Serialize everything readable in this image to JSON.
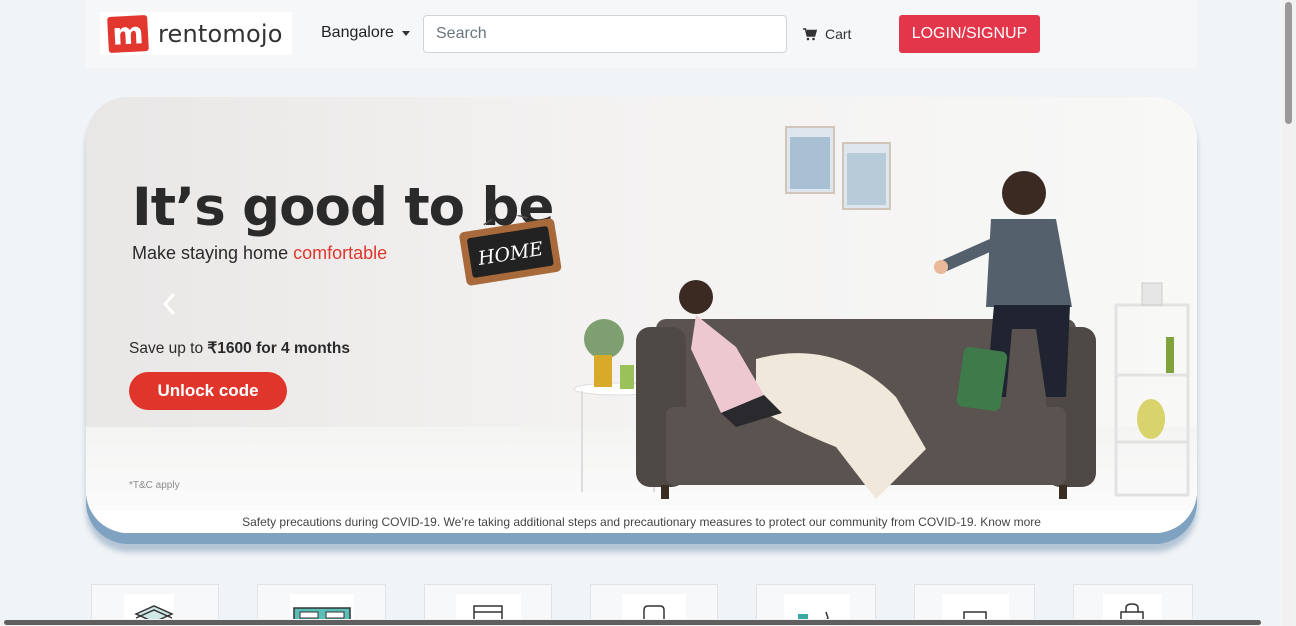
{
  "brand": {
    "logo_letter": "m",
    "name": "rentomojo",
    "accent_color": "#e2372f"
  },
  "header": {
    "city": "Bangalore",
    "search_placeholder": "Search",
    "cart_label": "Cart",
    "login_label": "LOGIN/SIGNUP",
    "login_color": "#e4364a"
  },
  "hero": {
    "headline": "It’s good to be",
    "sign_text": "HOME",
    "subline_prefix": "Make staying home ",
    "subline_accent": "comfortable",
    "save_prefix": "Save up to ",
    "save_amount": "₹1600 for 4 months",
    "cta_label": "Unlock code",
    "cta_color": "#e0352b",
    "tc": "*T&C apply"
  },
  "notice": {
    "text": "Safety precautions during COVID-19. We’re taking additional steps and precautionary measures to protect our community from COVID-19.",
    "link": "Know more"
  },
  "categories": [
    {
      "icon": "packages-icon"
    },
    {
      "icon": "bed-icon"
    },
    {
      "icon": "wardrobe-icon"
    },
    {
      "icon": "fridge-icon"
    },
    {
      "icon": "fitness-icon"
    },
    {
      "icon": "laptop-icon"
    },
    {
      "icon": "bag-icon"
    }
  ]
}
